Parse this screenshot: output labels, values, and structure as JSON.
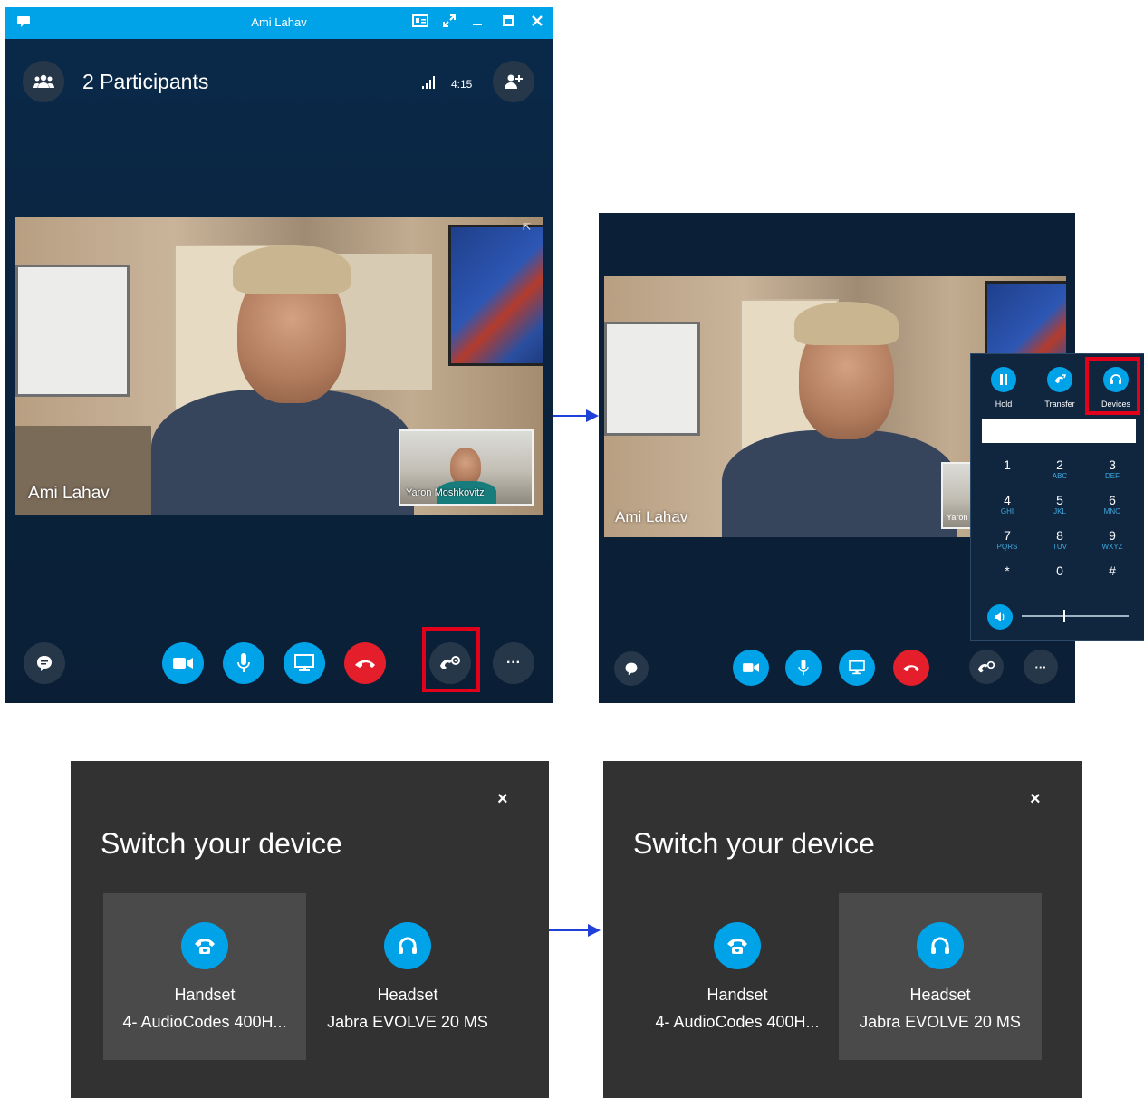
{
  "window1": {
    "title": "Ami Lahav",
    "participants_label": "2 Participants",
    "timer": "4:15",
    "main_video_name": "Ami Lahav",
    "pip_name": "Yaron Moshkovitz"
  },
  "window2": {
    "main_video_name": "Ami Lahav",
    "pip_name": "Yaron",
    "popup": {
      "buttons": [
        {
          "label": "Hold",
          "icon": "pause-icon"
        },
        {
          "label": "Transfer",
          "icon": "transfer-icon"
        },
        {
          "label": "Devices",
          "icon": "headset-icon"
        }
      ],
      "dialpad": [
        {
          "digit": "1",
          "letters": ""
        },
        {
          "digit": "2",
          "letters": "ABC"
        },
        {
          "digit": "3",
          "letters": "DEF"
        },
        {
          "digit": "4",
          "letters": "GHI"
        },
        {
          "digit": "5",
          "letters": "JKL"
        },
        {
          "digit": "6",
          "letters": "MNO"
        },
        {
          "digit": "7",
          "letters": "PQRS"
        },
        {
          "digit": "8",
          "letters": "TUV"
        },
        {
          "digit": "9",
          "letters": "WXYZ"
        },
        {
          "digit": "*",
          "letters": ""
        },
        {
          "digit": "0",
          "letters": ""
        },
        {
          "digit": "#",
          "letters": ""
        }
      ]
    }
  },
  "dialog1": {
    "close": "×",
    "title": "Switch your device",
    "devices": [
      {
        "name": "Handset",
        "detail": "4- AudioCodes 400H...",
        "icon": "handset-icon",
        "selected": true
      },
      {
        "name": "Headset",
        "detail": "Jabra EVOLVE 20 MS",
        "icon": "headset-icon",
        "selected": false
      }
    ]
  },
  "dialog2": {
    "close": "×",
    "title": "Switch your device",
    "devices": [
      {
        "name": "Handset",
        "detail": "4- AudioCodes 400H...",
        "icon": "handset-icon",
        "selected": false
      },
      {
        "name": "Headset",
        "detail": "Jabra EVOLVE 20 MS",
        "icon": "headset-icon",
        "selected": true
      }
    ]
  },
  "colors": {
    "accent": "#00a2e8",
    "end_call": "#e41e2b",
    "highlight": "#e3001b",
    "arrow": "#1f3fd9",
    "dialog_bg": "#323232"
  }
}
